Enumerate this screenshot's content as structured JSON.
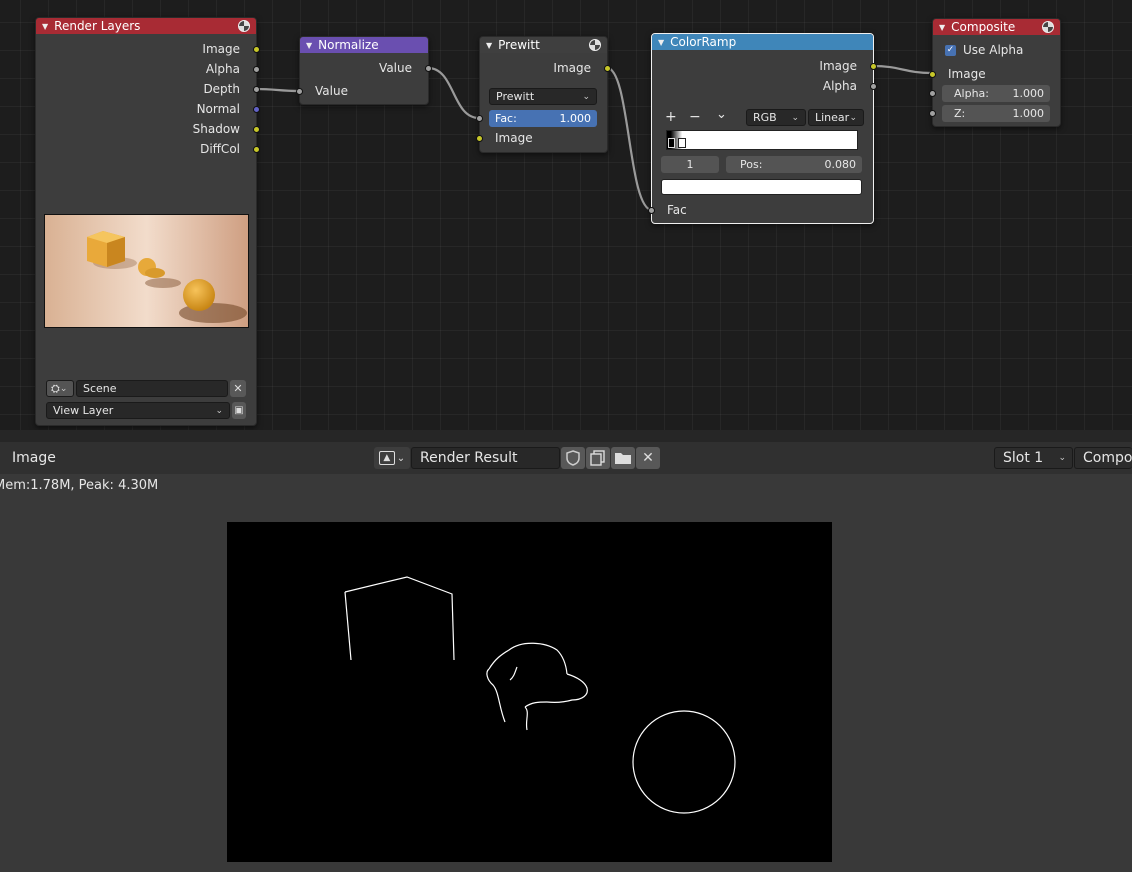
{
  "nodes": {
    "render_layers": {
      "title": "Render Layers",
      "outputs": [
        "Image",
        "Alpha",
        "Depth",
        "Normal",
        "Shadow",
        "DiffCol"
      ],
      "scene": "Scene",
      "view_layer": "View Layer",
      "header_color": "#a82b34"
    },
    "normalize": {
      "title": "Normalize",
      "output": "Value",
      "input": "Value",
      "header_color": "#6a4fb0"
    },
    "prewitt": {
      "title": "Prewitt",
      "output": "Image",
      "filter_type": "Prewitt",
      "fac_label": "Fac:",
      "fac_value": "1.000",
      "input": "Image",
      "header_color": "#3f3f3f"
    },
    "colorramp": {
      "title": "ColorRamp",
      "outputs": [
        "Image",
        "Alpha"
      ],
      "add": "+",
      "remove": "−",
      "menu": "⌄",
      "color_mode": "RGB",
      "interpolation": "Linear",
      "stop_index": "1",
      "pos_label": "Pos:",
      "pos_value": "0.080",
      "input": "Fac",
      "header_color": "#3f86b9"
    },
    "composite": {
      "title": "Composite",
      "use_alpha": "Use Alpha",
      "input": "Image",
      "alpha_label": "Alpha:",
      "alpha_value": "1.000",
      "z_label": "Z:",
      "z_value": "1.000",
      "header_color": "#a82b34"
    }
  },
  "image_editor": {
    "title": "Image",
    "image_name": "Render Result",
    "slot": "Slot 1",
    "view": "Compos",
    "stats": "Mem:1.78M, Peak: 4.30M"
  },
  "icons": {
    "image_type": "image-icon",
    "fake_user": "shield-icon",
    "new_image": "duplicate-icon",
    "open_image": "folder-icon",
    "unlink": "close-icon"
  }
}
